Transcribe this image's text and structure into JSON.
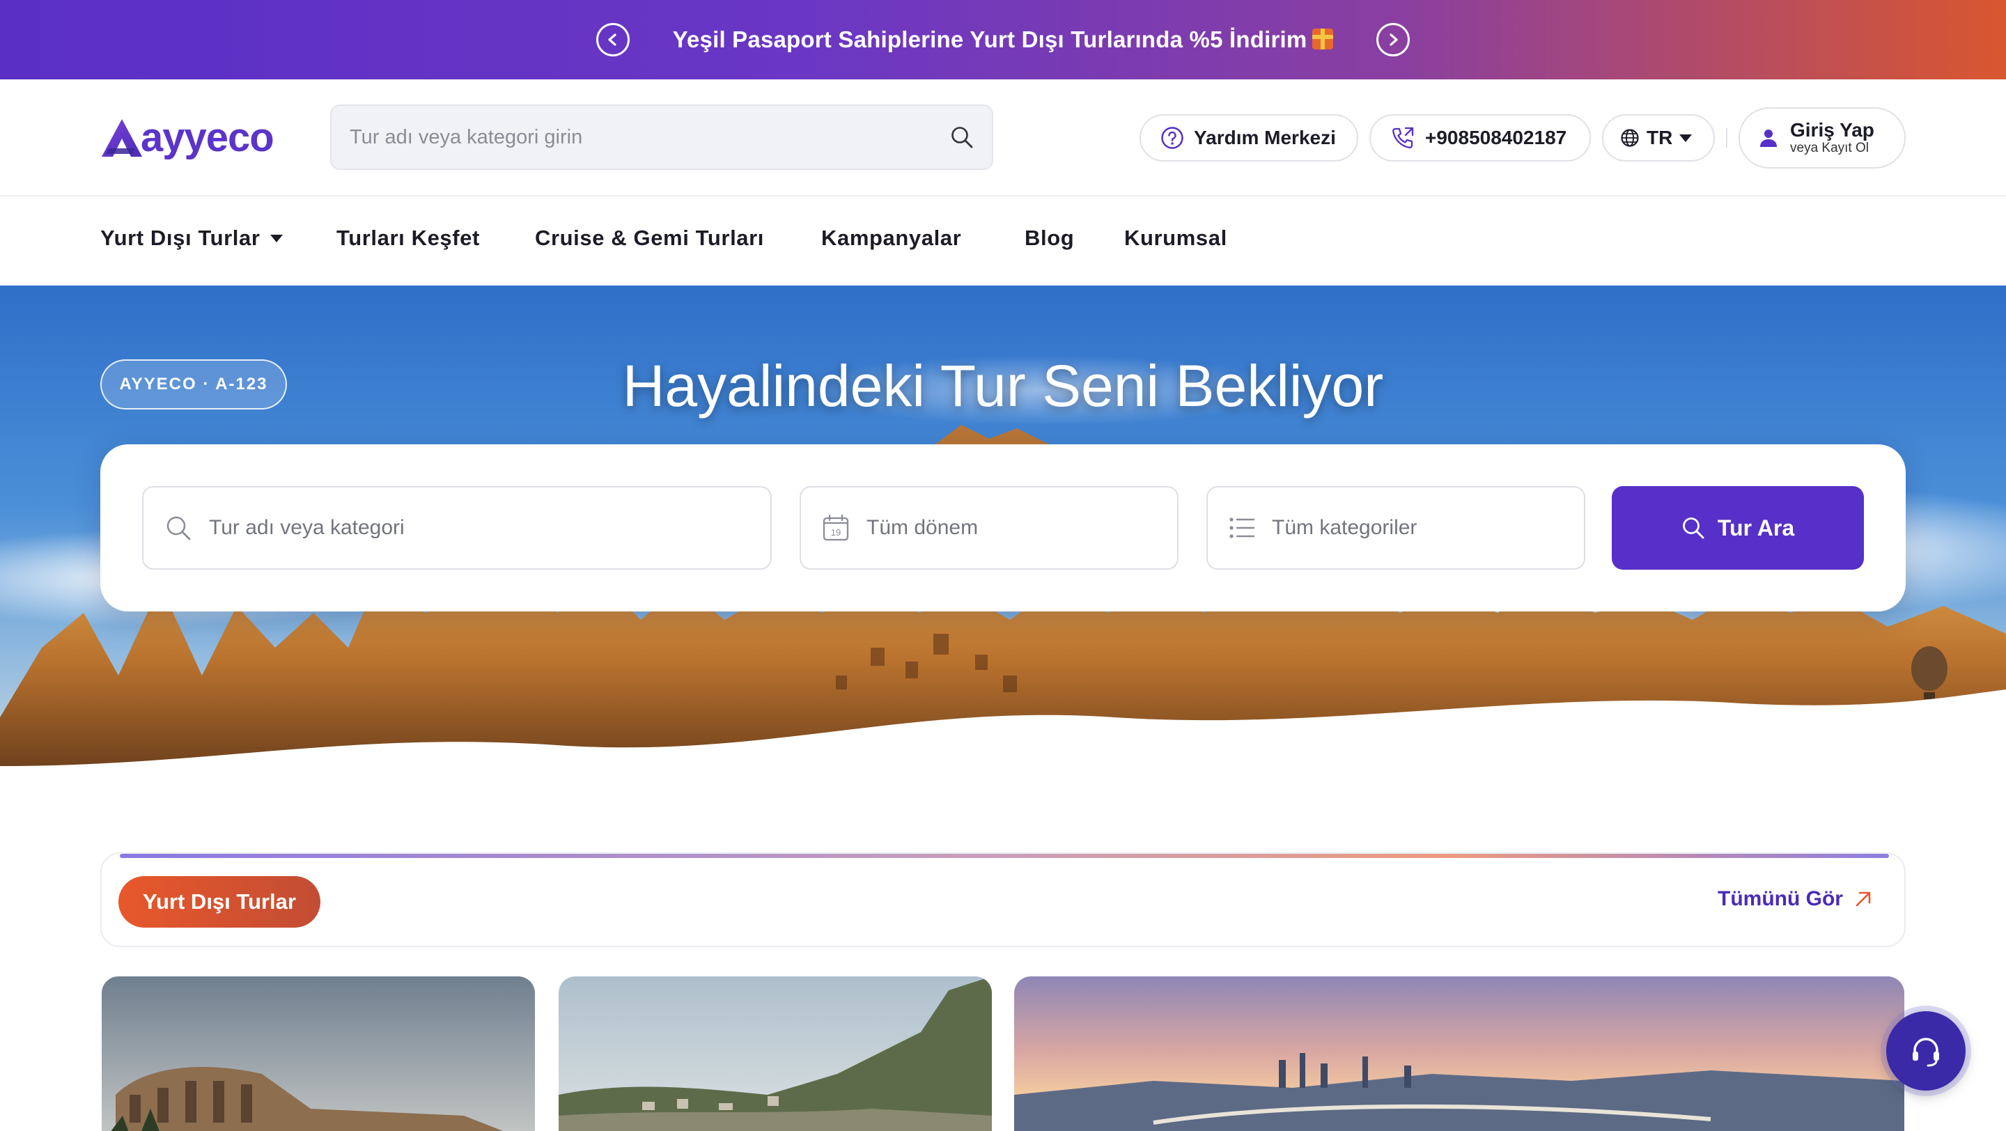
{
  "promo": {
    "text": "Yeşil Pasaport Sahiplerine Yurt Dışı Turlarında %5 İndirim",
    "icon": "gift-icon",
    "prev_icon": "chevron-left-icon",
    "next_icon": "chevron-right-icon"
  },
  "header": {
    "logo_text": "ayyeco",
    "search_placeholder": "Tur adı veya kategori girin",
    "help_label": "Yardım Merkezi",
    "phone": "+908508402187",
    "language": "TR",
    "login_label": "Giriş Yap",
    "register_label": "veya Kayıt Ol"
  },
  "nav": {
    "items": [
      {
        "label": "Yurt Dışı Turlar",
        "has_dropdown": true
      },
      {
        "label": "Turları Keşfet"
      },
      {
        "label": "Cruise & Gemi Turları"
      },
      {
        "label": "Kampanyalar"
      },
      {
        "label": "Blog"
      },
      {
        "label": "Kurumsal"
      }
    ]
  },
  "hero": {
    "badge": "AYYECO · A-123",
    "title": "Hayalindeki Tur Seni Bekliyor",
    "search": {
      "tour_placeholder": "Tur adı veya kategori",
      "period_value": "Tüm dönem",
      "date_icon_day": "19",
      "category_value": "Tüm kategoriler",
      "button_label": "Tur Ara"
    }
  },
  "section": {
    "tab_label": "Yurt Dışı Turlar",
    "see_all_label": "Tümünü Gör"
  },
  "colors": {
    "brand": "#5630c8",
    "accent": "#e8582b",
    "promo_start": "#5a2fc6",
    "promo_end": "#d9572f"
  }
}
